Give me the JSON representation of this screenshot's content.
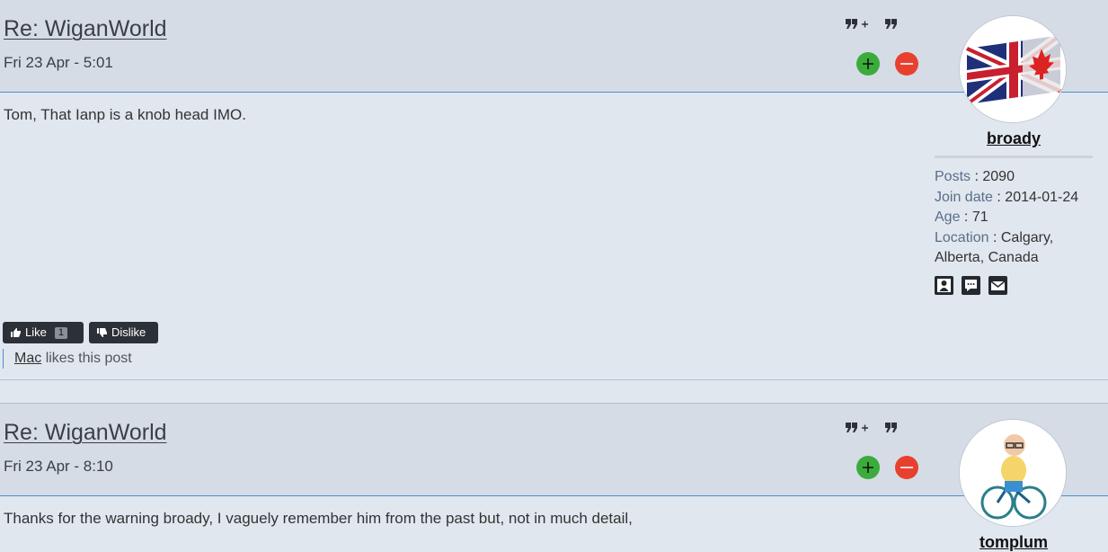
{
  "posts": [
    {
      "title": "Re: WiganWorld",
      "date": "Fri 23 Apr - 5:01",
      "content": "Tom, That Ianp is a knob head IMO.",
      "author": {
        "username": "broady",
        "avatar": "union-jack-maple-flag",
        "posts_label": "Posts",
        "posts": "2090",
        "join_label": "Join date",
        "join_date": "2014-01-24",
        "age_label": "Age",
        "age": "71",
        "location_label": "Location",
        "location": "Calgary, Alberta, Canada"
      },
      "like_label": "Like",
      "like_count": "1",
      "dislike_label": "Dislike",
      "liker": "Mac",
      "likes_text": "likes this post"
    },
    {
      "title": "Re: WiganWorld",
      "date": "Fri 23 Apr - 8:10",
      "content": "Thanks for the warning broady, I vaguely remember him from the past but, not in much detail,",
      "author": {
        "username": "tomplum",
        "avatar": "cyclist-cartoon"
      }
    }
  ],
  "separator": ":",
  "colors": {
    "vote_plus": "#3bac3b",
    "vote_minus": "#e8402f",
    "link_border": "#4a90c9",
    "button_dark": "#2c3138"
  }
}
